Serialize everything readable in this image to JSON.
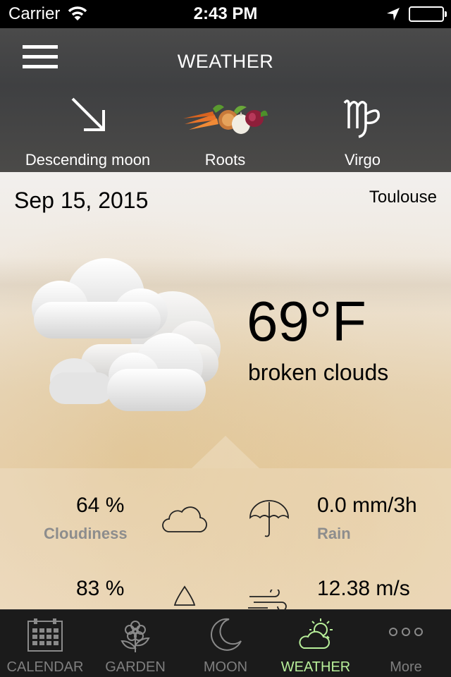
{
  "status_bar": {
    "carrier": "Carrier",
    "time": "2:43 PM",
    "icons": [
      "wifi-icon",
      "location-arrow-icon",
      "battery-icon"
    ]
  },
  "header": {
    "title": "WEATHER",
    "menu_icon": "hamburger-menu-icon",
    "moon": {
      "icon": "descending-arrow-icon",
      "label": "Descending moon"
    },
    "day_type": {
      "icon": "root-vegetables-icon",
      "label": "Roots"
    },
    "zodiac": {
      "icon": "virgo-sign-icon",
      "label": "Virgo"
    }
  },
  "main": {
    "date": "Sep 15, 2015",
    "city": "Toulouse",
    "weather_icon": "broken-clouds-icon",
    "temperature": "69°F",
    "description": "broken clouds"
  },
  "details": {
    "cloudiness": {
      "value": "64 %",
      "label": "Cloudiness",
      "icon": "cloud-icon"
    },
    "rain": {
      "value": "0.0 mm/3h",
      "label": "Rain",
      "icon": "umbrella-icon"
    },
    "humidity": {
      "value": "83 %",
      "icon": "drop-icon"
    },
    "wind": {
      "value": "12.38 m/s",
      "icon": "wind-icon"
    }
  },
  "tabs": [
    {
      "label": "CALENDAR",
      "icon": "calendar-icon",
      "active": false
    },
    {
      "label": "GARDEN",
      "icon": "flower-icon",
      "active": false
    },
    {
      "label": "MOON",
      "icon": "crescent-moon-icon",
      "active": false
    },
    {
      "label": "WEATHER",
      "icon": "sun-cloud-icon",
      "active": true
    },
    {
      "label": "More",
      "icon": "more-dots-icon",
      "active": false
    }
  ],
  "colors": {
    "active_tab": "#b8ef9a",
    "inactive_tab": "#7f7f7f",
    "detail_label": "#8d8d8d",
    "header_bg": "#424345",
    "tabbar_bg": "#1b1b1b"
  }
}
